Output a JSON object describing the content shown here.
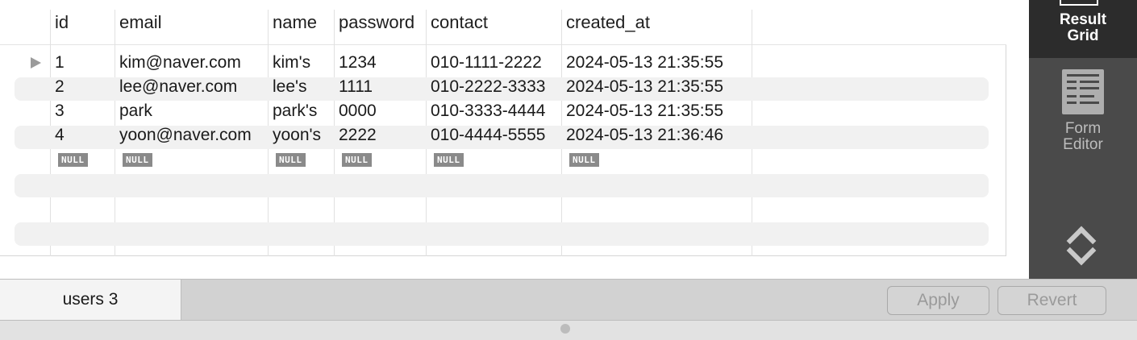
{
  "grid": {
    "columns": [
      "id",
      "email",
      "name",
      "password",
      "contact",
      "created_at"
    ],
    "rows": [
      {
        "id": "1",
        "email": "kim@naver.com",
        "name": "kim's",
        "password": "1234",
        "contact": "010-1111-2222",
        "created_at": "2024-05-13 21:35:55"
      },
      {
        "id": "2",
        "email": "lee@naver.com",
        "name": "lee's",
        "password": "1111",
        "contact": "010-2222-3333",
        "created_at": "2024-05-13 21:35:55"
      },
      {
        "id": "3",
        "email": "park",
        "name": "park's",
        "password": "0000",
        "contact": "010-3333-4444",
        "created_at": "2024-05-13 21:35:55"
      },
      {
        "id": "4",
        "email": "yoon@naver.com",
        "name": "yoon's",
        "password": "2222",
        "contact": "010-4444-5555",
        "created_at": "2024-05-13 21:36:46"
      }
    ],
    "null_label": "NULL"
  },
  "side_panel": {
    "result_grid": {
      "line1": "Result",
      "line2": "Grid",
      "icon": "result-grid-icon"
    },
    "form_editor": {
      "line1": "Form",
      "line2": "Editor",
      "icon": "form-editor-icon"
    },
    "scroll_icon": "scroll-up-down-icon"
  },
  "bottom_bar": {
    "tab_label": "users 3",
    "apply_label": "Apply",
    "revert_label": "Revert"
  },
  "colors": {
    "panel_background": "#4a4a4a",
    "panel_active": "#2c2c2c",
    "null_badge": "#8a8a8a",
    "row_stripe": "#f1f1f1"
  }
}
